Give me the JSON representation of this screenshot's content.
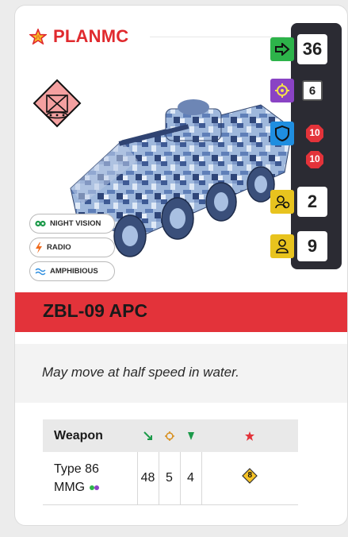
{
  "faction": {
    "name": "PLANMC",
    "icon": "star-emblem-icon"
  },
  "unit_symbol": {
    "icon": "mechanized-infantry-symbol-icon"
  },
  "vehicle_image": {
    "icon": "zbl-09-apc-digital-camo-image"
  },
  "stats": {
    "move": {
      "icon": "move-arrow-icon",
      "value": "36",
      "color": "#2db34a"
    },
    "quality": {
      "icon": "quality-gear-icon",
      "value": "6",
      "color": "#8a43c4"
    },
    "armor": {
      "icon": "shield-icon",
      "front": "10",
      "side": "10",
      "color": "#1f8ee0"
    },
    "transport": {
      "icon": "crew-helmet-icon",
      "value": "2",
      "color": "#e8c31e"
    },
    "passengers": {
      "icon": "passenger-icon",
      "value": "9",
      "color": "#e8c31e"
    }
  },
  "abilities": [
    {
      "icon": "night-vision-icon",
      "label": "NIGHT VISION",
      "color": "#1c9a4a"
    },
    {
      "icon": "radio-bolt-icon",
      "label": "RADIO",
      "color": "#f06a1b"
    },
    {
      "icon": "waves-icon",
      "label": "AMPHIBIOUS",
      "color": "#2f8fe0"
    }
  ],
  "unit": {
    "name": "ZBL-09 APC"
  },
  "special_rule": "May move at half speed in water.",
  "weapons": {
    "header": {
      "name": "Weapon",
      "col_range_icon": "range-arrow-icon",
      "col_accuracy_icon": "crosshair-icon",
      "col_damage_icon": "damage-arrow-icon",
      "col_special_icon": "special-burst-icon"
    },
    "rows": [
      {
        "name_line1": "Type 86",
        "name_line2": "MMG",
        "tag_icon": "suppression-tag-icon",
        "range": "48",
        "accuracy": "5",
        "damage": "4",
        "special": "8"
      }
    ]
  },
  "colors": {
    "accent": "#e3333a",
    "panel": "#2b2b33"
  }
}
